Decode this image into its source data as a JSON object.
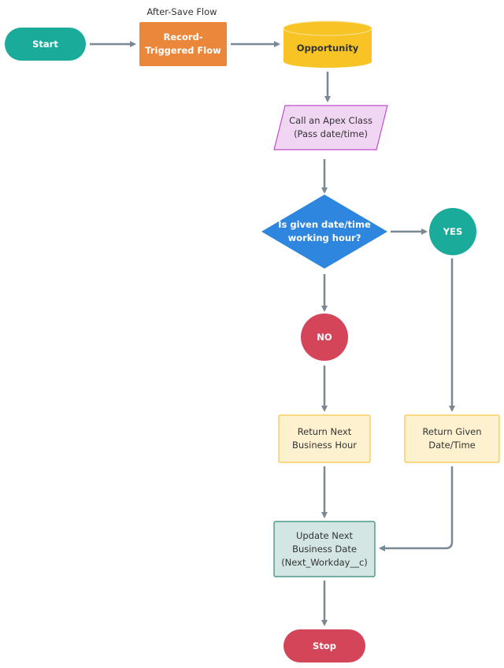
{
  "diagram": {
    "annotations": {
      "after_save": "After-Save Flow"
    },
    "nodes": {
      "start": {
        "label": "Start",
        "shape": "terminator",
        "color": "#1aab9b"
      },
      "record_triggered": {
        "label": "Record-\nTriggered Flow",
        "shape": "process",
        "color": "#ea873a"
      },
      "opportunity": {
        "label": "Opportunity",
        "shape": "database",
        "color": "#f7c325"
      },
      "apex": {
        "label": "Call an Apex Class\n(Pass date/time)",
        "shape": "parallelogram",
        "color": "#f0d6f3",
        "border": "#c14cd0"
      },
      "decision": {
        "label": "Is given date/time\nworking hour?",
        "shape": "diamond",
        "color": "#2f86de"
      },
      "yes": {
        "label": "YES",
        "shape": "circle",
        "color": "#1aab9b"
      },
      "no": {
        "label": "NO",
        "shape": "circle",
        "color": "#d5455a"
      },
      "next_hour": {
        "label": "Return Next\nBusiness Hour",
        "shape": "process",
        "color": "#fdf1cf",
        "border": "#f5c64a"
      },
      "given_dt": {
        "label": "Return Given\nDate/Time",
        "shape": "process",
        "color": "#fdf1cf",
        "border": "#f5c64a"
      },
      "update": {
        "label": "Update Next\nBusiness Date\n(Next_Workday__c)",
        "shape": "process",
        "color": "#d3e6e3",
        "border": "#2f8a74"
      },
      "stop": {
        "label": "Stop",
        "shape": "terminator",
        "color": "#d5455a"
      }
    },
    "edges": [
      {
        "from": "start",
        "to": "record_triggered"
      },
      {
        "from": "record_triggered",
        "to": "opportunity"
      },
      {
        "from": "opportunity",
        "to": "apex"
      },
      {
        "from": "apex",
        "to": "decision"
      },
      {
        "from": "decision",
        "to": "yes"
      },
      {
        "from": "decision",
        "to": "no"
      },
      {
        "from": "no",
        "to": "next_hour"
      },
      {
        "from": "yes",
        "to": "given_dt"
      },
      {
        "from": "next_hour",
        "to": "update"
      },
      {
        "from": "given_dt",
        "to": "update"
      },
      {
        "from": "update",
        "to": "stop"
      }
    ],
    "edge_color": "#7a8794"
  }
}
